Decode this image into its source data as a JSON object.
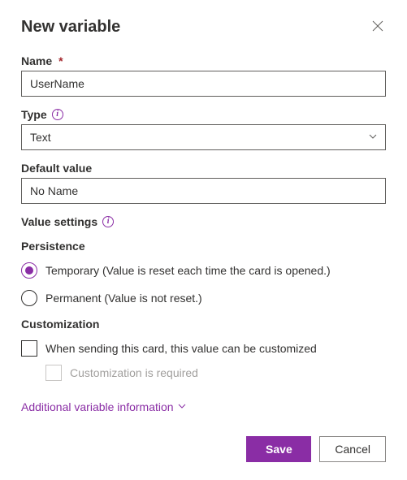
{
  "dialog": {
    "title": "New variable"
  },
  "fields": {
    "name": {
      "label": "Name",
      "value": "UserName"
    },
    "type": {
      "label": "Type",
      "value": "Text"
    },
    "default_value": {
      "label": "Default value",
      "value": "No Name"
    }
  },
  "value_settings": {
    "heading": "Value settings",
    "persistence": {
      "heading": "Persistence",
      "temporary_label": "Temporary (Value is reset each time the card is opened.)",
      "permanent_label": "Permanent (Value is not reset.)"
    },
    "customization": {
      "heading": "Customization",
      "allow_label": "When sending this card, this value can be customized",
      "required_label": "Customization is required"
    }
  },
  "expander": {
    "label": "Additional variable information"
  },
  "buttons": {
    "save": "Save",
    "cancel": "Cancel"
  }
}
